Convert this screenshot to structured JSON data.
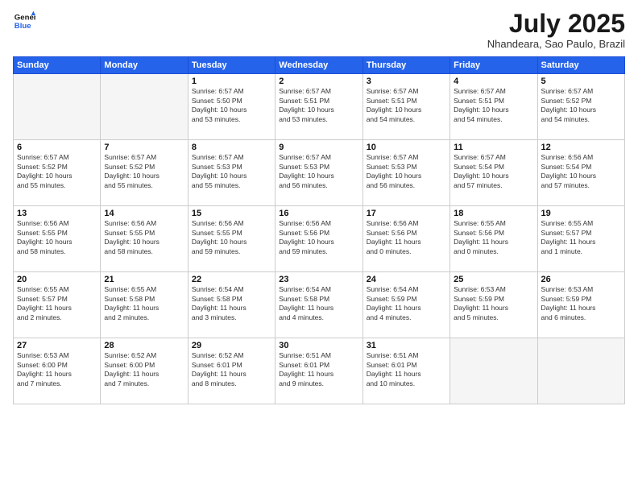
{
  "header": {
    "logo_line1": "General",
    "logo_line2": "Blue",
    "month": "July 2025",
    "location": "Nhandeara, Sao Paulo, Brazil"
  },
  "days_of_week": [
    "Sunday",
    "Monday",
    "Tuesday",
    "Wednesday",
    "Thursday",
    "Friday",
    "Saturday"
  ],
  "weeks": [
    [
      {
        "day": "",
        "info": ""
      },
      {
        "day": "",
        "info": ""
      },
      {
        "day": "1",
        "info": "Sunrise: 6:57 AM\nSunset: 5:50 PM\nDaylight: 10 hours\nand 53 minutes."
      },
      {
        "day": "2",
        "info": "Sunrise: 6:57 AM\nSunset: 5:51 PM\nDaylight: 10 hours\nand 53 minutes."
      },
      {
        "day": "3",
        "info": "Sunrise: 6:57 AM\nSunset: 5:51 PM\nDaylight: 10 hours\nand 54 minutes."
      },
      {
        "day": "4",
        "info": "Sunrise: 6:57 AM\nSunset: 5:51 PM\nDaylight: 10 hours\nand 54 minutes."
      },
      {
        "day": "5",
        "info": "Sunrise: 6:57 AM\nSunset: 5:52 PM\nDaylight: 10 hours\nand 54 minutes."
      }
    ],
    [
      {
        "day": "6",
        "info": "Sunrise: 6:57 AM\nSunset: 5:52 PM\nDaylight: 10 hours\nand 55 minutes."
      },
      {
        "day": "7",
        "info": "Sunrise: 6:57 AM\nSunset: 5:52 PM\nDaylight: 10 hours\nand 55 minutes."
      },
      {
        "day": "8",
        "info": "Sunrise: 6:57 AM\nSunset: 5:53 PM\nDaylight: 10 hours\nand 55 minutes."
      },
      {
        "day": "9",
        "info": "Sunrise: 6:57 AM\nSunset: 5:53 PM\nDaylight: 10 hours\nand 56 minutes."
      },
      {
        "day": "10",
        "info": "Sunrise: 6:57 AM\nSunset: 5:53 PM\nDaylight: 10 hours\nand 56 minutes."
      },
      {
        "day": "11",
        "info": "Sunrise: 6:57 AM\nSunset: 5:54 PM\nDaylight: 10 hours\nand 57 minutes."
      },
      {
        "day": "12",
        "info": "Sunrise: 6:56 AM\nSunset: 5:54 PM\nDaylight: 10 hours\nand 57 minutes."
      }
    ],
    [
      {
        "day": "13",
        "info": "Sunrise: 6:56 AM\nSunset: 5:55 PM\nDaylight: 10 hours\nand 58 minutes."
      },
      {
        "day": "14",
        "info": "Sunrise: 6:56 AM\nSunset: 5:55 PM\nDaylight: 10 hours\nand 58 minutes."
      },
      {
        "day": "15",
        "info": "Sunrise: 6:56 AM\nSunset: 5:55 PM\nDaylight: 10 hours\nand 59 minutes."
      },
      {
        "day": "16",
        "info": "Sunrise: 6:56 AM\nSunset: 5:56 PM\nDaylight: 10 hours\nand 59 minutes."
      },
      {
        "day": "17",
        "info": "Sunrise: 6:56 AM\nSunset: 5:56 PM\nDaylight: 11 hours\nand 0 minutes."
      },
      {
        "day": "18",
        "info": "Sunrise: 6:55 AM\nSunset: 5:56 PM\nDaylight: 11 hours\nand 0 minutes."
      },
      {
        "day": "19",
        "info": "Sunrise: 6:55 AM\nSunset: 5:57 PM\nDaylight: 11 hours\nand 1 minute."
      }
    ],
    [
      {
        "day": "20",
        "info": "Sunrise: 6:55 AM\nSunset: 5:57 PM\nDaylight: 11 hours\nand 2 minutes."
      },
      {
        "day": "21",
        "info": "Sunrise: 6:55 AM\nSunset: 5:58 PM\nDaylight: 11 hours\nand 2 minutes."
      },
      {
        "day": "22",
        "info": "Sunrise: 6:54 AM\nSunset: 5:58 PM\nDaylight: 11 hours\nand 3 minutes."
      },
      {
        "day": "23",
        "info": "Sunrise: 6:54 AM\nSunset: 5:58 PM\nDaylight: 11 hours\nand 4 minutes."
      },
      {
        "day": "24",
        "info": "Sunrise: 6:54 AM\nSunset: 5:59 PM\nDaylight: 11 hours\nand 4 minutes."
      },
      {
        "day": "25",
        "info": "Sunrise: 6:53 AM\nSunset: 5:59 PM\nDaylight: 11 hours\nand 5 minutes."
      },
      {
        "day": "26",
        "info": "Sunrise: 6:53 AM\nSunset: 5:59 PM\nDaylight: 11 hours\nand 6 minutes."
      }
    ],
    [
      {
        "day": "27",
        "info": "Sunrise: 6:53 AM\nSunset: 6:00 PM\nDaylight: 11 hours\nand 7 minutes."
      },
      {
        "day": "28",
        "info": "Sunrise: 6:52 AM\nSunset: 6:00 PM\nDaylight: 11 hours\nand 7 minutes."
      },
      {
        "day": "29",
        "info": "Sunrise: 6:52 AM\nSunset: 6:01 PM\nDaylight: 11 hours\nand 8 minutes."
      },
      {
        "day": "30",
        "info": "Sunrise: 6:51 AM\nSunset: 6:01 PM\nDaylight: 11 hours\nand 9 minutes."
      },
      {
        "day": "31",
        "info": "Sunrise: 6:51 AM\nSunset: 6:01 PM\nDaylight: 11 hours\nand 10 minutes."
      },
      {
        "day": "",
        "info": ""
      },
      {
        "day": "",
        "info": ""
      }
    ]
  ]
}
